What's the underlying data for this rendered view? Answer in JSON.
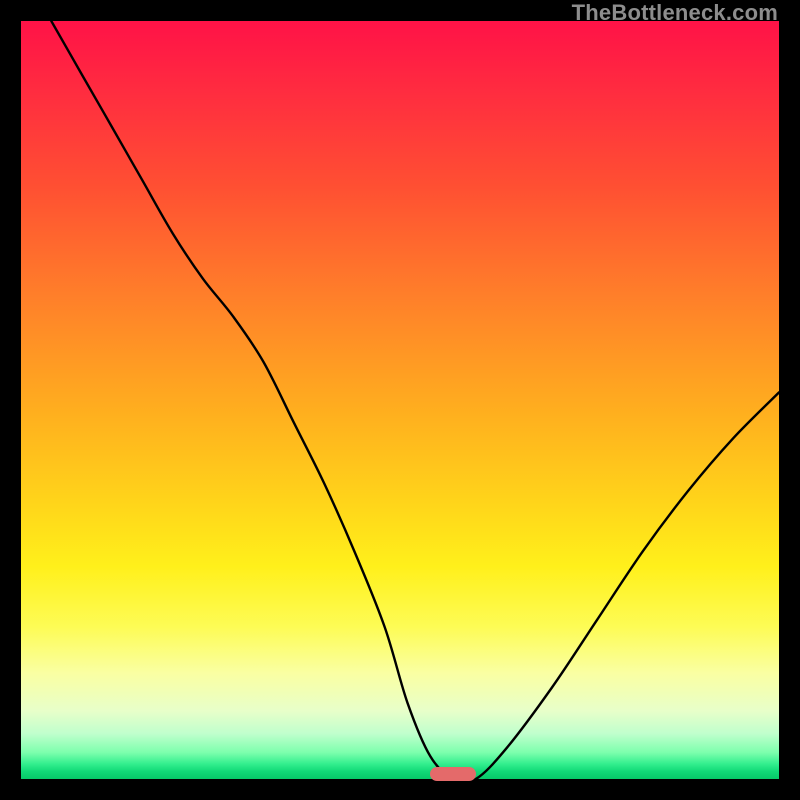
{
  "watermark": "TheBottleneck.com",
  "chart_data": {
    "type": "line",
    "title": "",
    "xlabel": "",
    "ylabel": "",
    "xlim": [
      0,
      100
    ],
    "ylim": [
      0,
      100
    ],
    "grid": false,
    "background_gradient": {
      "top_color": "#ff1247",
      "mid_color": "#ffe01a",
      "bottom_color": "#06c968"
    },
    "series": [
      {
        "name": "bottleneck-curve",
        "color": "#000000",
        "x": [
          4,
          8,
          12,
          16,
          20,
          24,
          28,
          32,
          36,
          40,
          44,
          48,
          51,
          54,
          57,
          60,
          64,
          70,
          76,
          82,
          88,
          94,
          100
        ],
        "y": [
          100,
          93,
          86,
          79,
          72,
          66,
          61,
          55,
          47,
          39,
          30,
          20,
          10,
          3,
          0,
          0,
          4,
          12,
          21,
          30,
          38,
          45,
          51
        ]
      }
    ],
    "marker": {
      "name": "optimal-range",
      "color": "#e46a6a",
      "x_start": 54,
      "x_end": 60,
      "y": 0
    }
  }
}
